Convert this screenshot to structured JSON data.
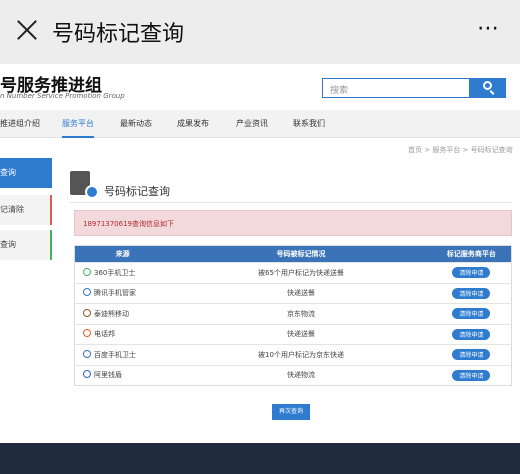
{
  "window": {
    "title": "号码标记查询",
    "more_icon": "⋯"
  },
  "brand": {
    "name": "号服务推进组",
    "subtitle": "n Number Service Promotion Group"
  },
  "search": {
    "placeholder": "搜索"
  },
  "nav": {
    "items": [
      "推进组介绍",
      "服务平台",
      "最新动态",
      "成果发布",
      "产业资讯",
      "联系我们"
    ],
    "active": "服务平台"
  },
  "breadcrumb": "首页 > 服务平台 > 号码标记查询",
  "sidebar": {
    "items": [
      "查询",
      "记清除",
      "查询"
    ]
  },
  "main": {
    "title": "号码标记查询",
    "alert": "18971370619查询信息如下"
  },
  "table": {
    "headers": [
      "来源",
      "号码被标记情况",
      "标记服务商平台"
    ],
    "rows": [
      {
        "source": "360手机卫士",
        "status": "被65个用户标记为快递送餐",
        "action": "清除申请",
        "icon": "green-shield-icon",
        "color": "#3fb560"
      },
      {
        "source": "腾讯手机管家",
        "status": "快递送餐",
        "action": "清除申请",
        "icon": "blue-tencent-icon",
        "color": "#2f7bd0"
      },
      {
        "source": "泰迪熊移动",
        "status": "京东物流",
        "action": "清除申请",
        "icon": "bear-icon",
        "color": "#8a5a2b"
      },
      {
        "source": "电话邦",
        "status": "快递送餐",
        "action": "清除申请",
        "icon": "orange-phone-icon",
        "color": "#f05a22"
      },
      {
        "source": "百度手机卫士",
        "status": "被10个用户标记为京东快递",
        "action": "清除申请",
        "icon": "baidu-shield-icon",
        "color": "#3a73b8"
      },
      {
        "source": "阿里钱盾",
        "status": "快递物流",
        "action": "清除申请",
        "icon": "ali-shield-icon",
        "color": "#2b5fd6"
      }
    ]
  },
  "query_again": "再次查询"
}
